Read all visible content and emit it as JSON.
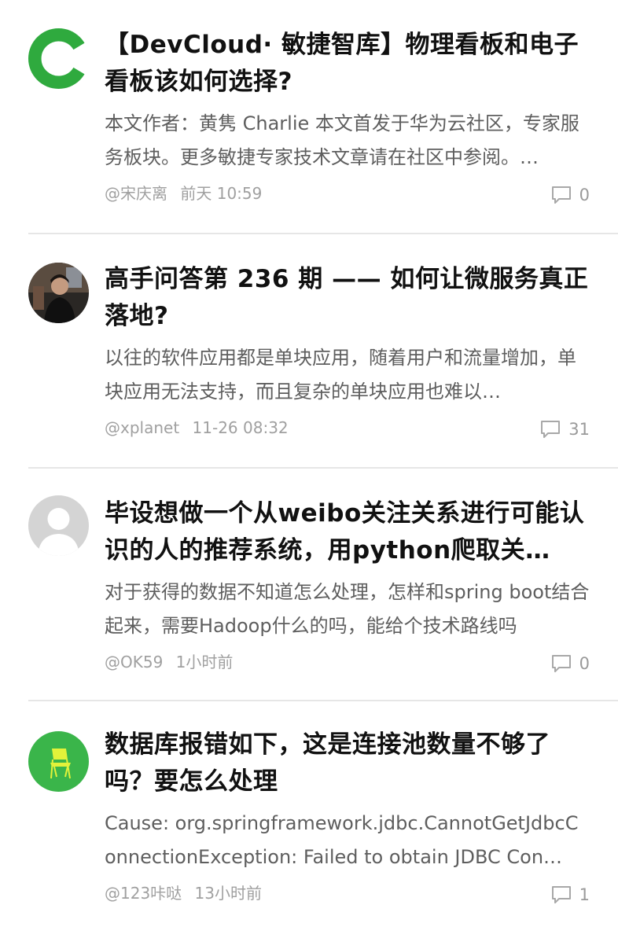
{
  "posts": [
    {
      "avatar": "devcloud-logo-avatar",
      "title": "【DevCloud· 敏捷智库】物理看板和电子看板该如何选择?",
      "summary": "本文作者：黄隽 Charlie 本文首发于华为云社区，专家服务板块。更多敏捷专家技术文章请在社区中参阅。…",
      "author": "@宋庆离",
      "time": "前天 10:59",
      "comments": "0"
    },
    {
      "avatar": "person-photo-avatar",
      "title": "高手问答第 236 期 —— 如何让微服务真正落地?",
      "summary": "以往的软件应用都是单块应用，随着用户和流量增加，单块应用无法支持，而且复杂的单块应用也难以…",
      "author": "@xplanet",
      "time": "11-26 08:32",
      "comments": "31"
    },
    {
      "avatar": "default-gray-avatar",
      "title": "毕设想做一个从weibo关注关系进行可能认识的人的推荐系统，用python爬取关…",
      "summary": "对于获得的数据不知道怎么处理，怎样和spring boot结合起来，需要Hadoop什么的吗，能给个技术路线吗",
      "author": "@OK59",
      "time": "1小时前",
      "comments": "0"
    },
    {
      "avatar": "green-chair-avatar",
      "title": "数据库报错如下，这是连接池数量不够了吗？要怎么处理",
      "summary": "Cause: org.springframework.jdbc.CannotGetJdbcConnectionException: Failed to obtain JDBC Con…",
      "author": "@123咔哒",
      "time": "13小时前",
      "comments": "1"
    }
  ],
  "colors": {
    "devcloud_green": "#2faa3e",
    "chair_bg": "#3ab54a",
    "chair_yellow": "#e3f23a",
    "default_avatar": "#d4d4d4"
  }
}
